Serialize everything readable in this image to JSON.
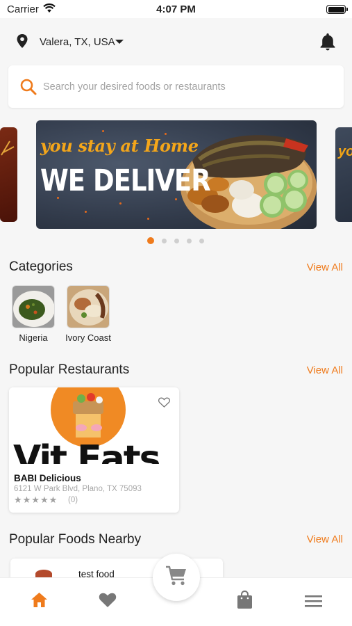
{
  "status_bar": {
    "carrier": "Carrier",
    "time": "4:07 PM"
  },
  "location": {
    "text": "Valera, TX, USA"
  },
  "search": {
    "placeholder": "Search your desired foods or restaurants"
  },
  "banner": {
    "tagline": "you stay at Home",
    "headline": "WE DELIVER",
    "slide_count": 5,
    "active_slide": 1
  },
  "categories": {
    "title": "Categories",
    "view_all": "View All",
    "items": [
      {
        "label": "Nigeria"
      },
      {
        "label": "Ivory Coast"
      }
    ]
  },
  "popular_restaurants": {
    "title": "Popular Restaurants",
    "view_all": "View All",
    "items": [
      {
        "logo_text": "Vit Eats",
        "name": "BABI Delicious",
        "address": "6121 W Park Blvd, Plano, TX 75093",
        "rating": 0,
        "stars_text": "★★★★★",
        "review_count": "(0)"
      }
    ]
  },
  "popular_foods": {
    "title": "Popular Foods Nearby",
    "view_all": "View All",
    "items": [
      {
        "name": "test food"
      }
    ]
  },
  "colors": {
    "accent": "#ef7b1c",
    "background": "#f6f6f6"
  },
  "bottom_nav": {
    "items": [
      "home-icon",
      "heart-icon",
      "cart-icon",
      "bag-icon",
      "menu-icon"
    ],
    "active": "home-icon"
  }
}
